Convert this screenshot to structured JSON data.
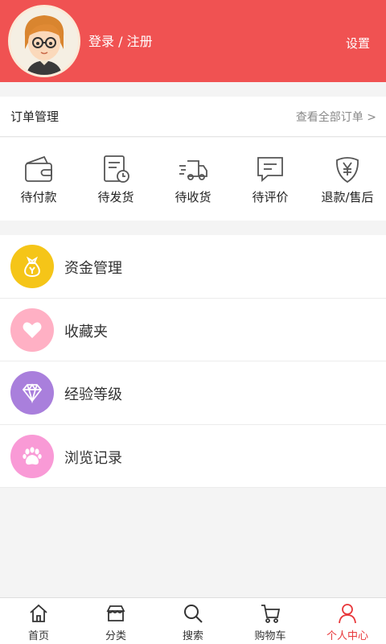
{
  "header": {
    "login_label": "登录 / 注册",
    "settings_label": "设置",
    "bg_color": "#f05252"
  },
  "orders": {
    "title": "订单管理",
    "view_all": "查看全部订单 >",
    "items": [
      {
        "label": "待付款",
        "icon": "wallet-icon"
      },
      {
        "label": "待发货",
        "icon": "clipboard-clock-icon"
      },
      {
        "label": "待收货",
        "icon": "truck-icon"
      },
      {
        "label": "待评价",
        "icon": "comment-icon"
      },
      {
        "label": "退款/售后",
        "icon": "yen-shield-icon"
      }
    ]
  },
  "menu": {
    "items": [
      {
        "label": "资金管理",
        "icon": "money-bag-icon",
        "color": "#f5c518"
      },
      {
        "label": "收藏夹",
        "icon": "heart-icon",
        "color": "#ffb0c4"
      },
      {
        "label": "经验等级",
        "icon": "diamond-icon",
        "color": "#a97fdc"
      },
      {
        "label": "浏览记录",
        "icon": "paw-icon",
        "color": "#f99ad6"
      }
    ]
  },
  "tabbar": {
    "items": [
      {
        "label": "首页",
        "icon": "home-icon"
      },
      {
        "label": "分类",
        "icon": "category-icon"
      },
      {
        "label": "搜索",
        "icon": "search-icon"
      },
      {
        "label": "购物车",
        "icon": "cart-icon"
      },
      {
        "label": "个人中心",
        "icon": "person-icon",
        "active": true
      }
    ],
    "active_color": "#e8383b"
  }
}
